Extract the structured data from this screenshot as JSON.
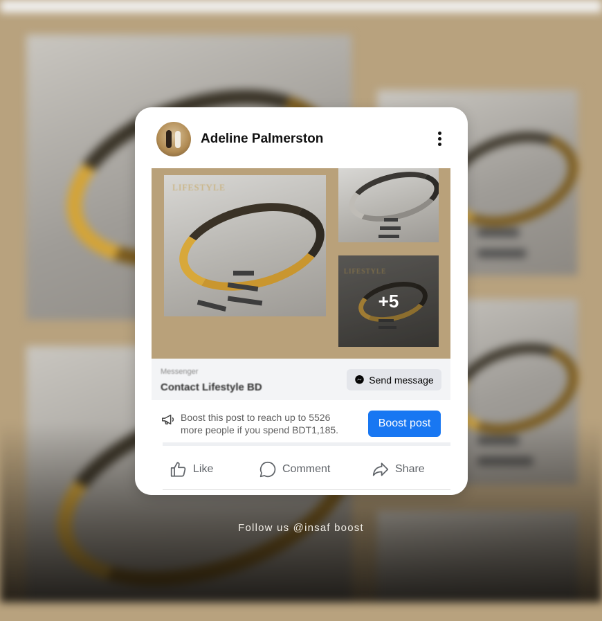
{
  "post": {
    "author_name": "Adeline Palmerston",
    "media_overlay_count": "+5",
    "logo_text": "LIFESTYLE"
  },
  "messenger": {
    "label": "Messenger",
    "title": "Contact Lifestyle BD",
    "send_label": "Send message"
  },
  "boost": {
    "text": "Boost this post to reach up to 5526 more people if you spend BDT1,185.",
    "button_label": "Boost post"
  },
  "actions": {
    "like": "Like",
    "comment": "Comment",
    "share": "Share"
  },
  "footer": {
    "text": "Follow us @insaf boost"
  },
  "colors": {
    "accent": "#1877f2",
    "background": "#b8a27e",
    "gold": "#c9a24a"
  },
  "icons": [
    "more-icon",
    "messenger-icon",
    "megaphone-icon",
    "like-icon",
    "comment-icon",
    "share-icon"
  ]
}
